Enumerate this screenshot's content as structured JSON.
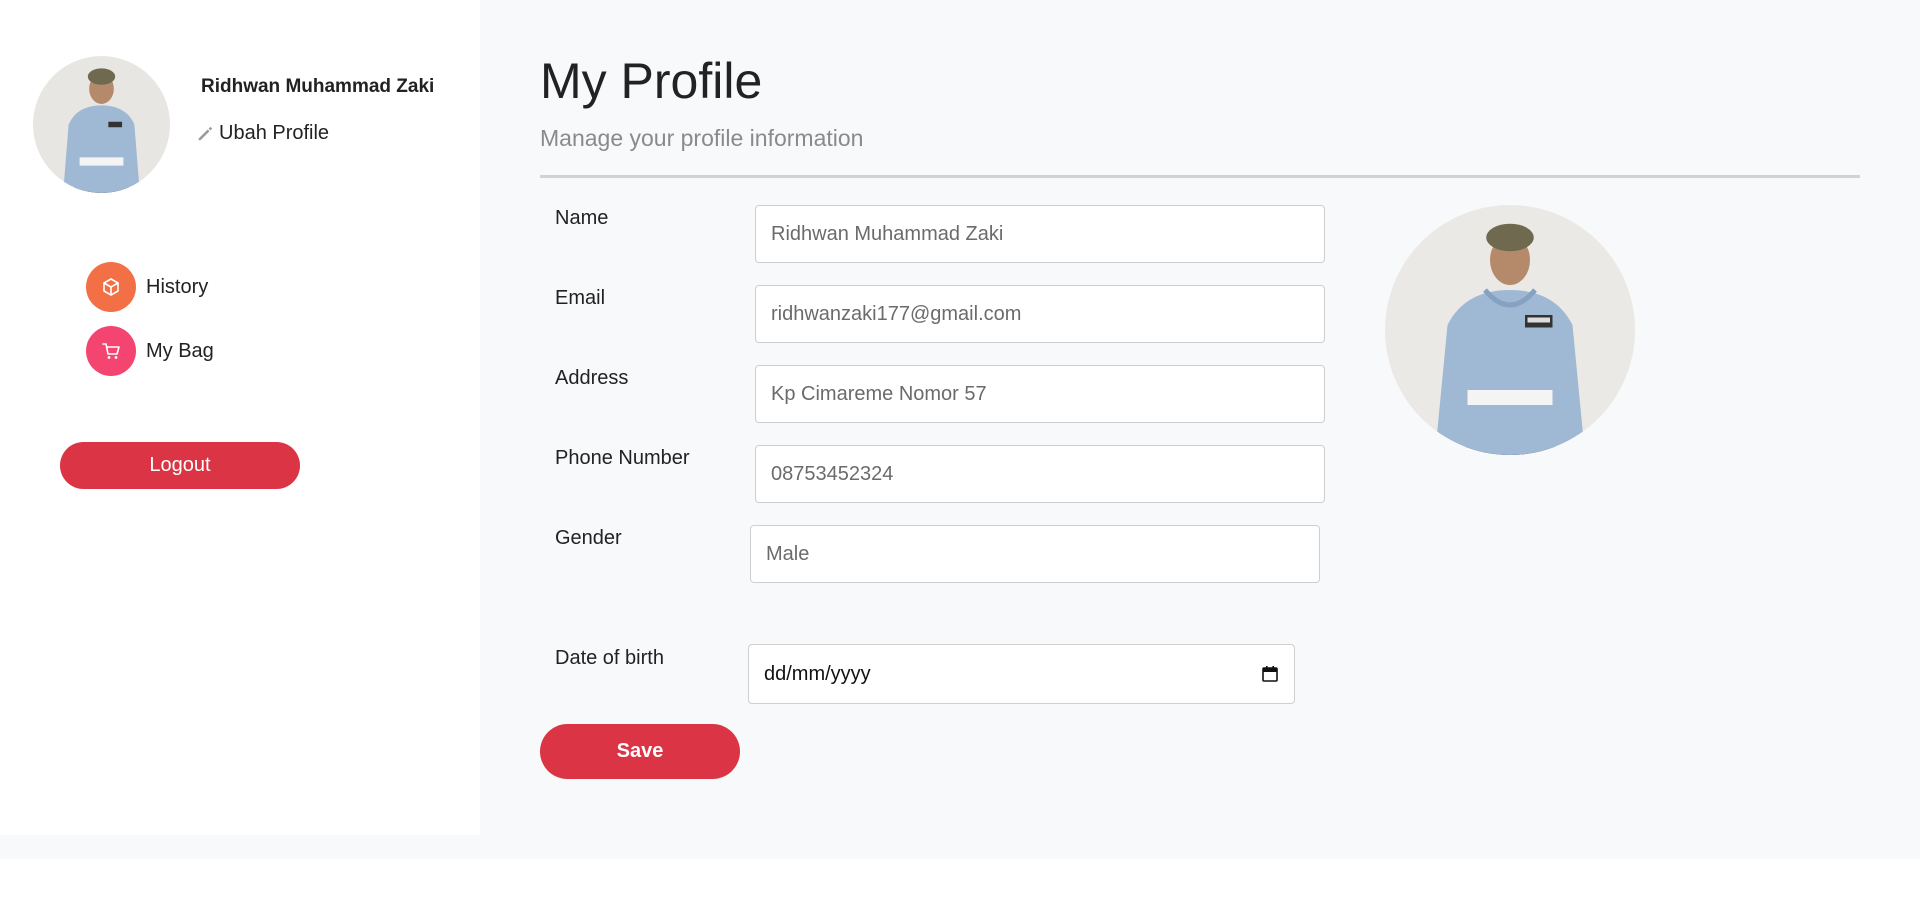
{
  "sidebar": {
    "user_name": "Ridhwan Muhammad Zaki",
    "edit_profile_label": "Ubah Profile",
    "nav_items": [
      {
        "label": "History",
        "icon": "package-icon",
        "color": "#f36f45"
      },
      {
        "label": "My Bag",
        "icon": "cart-icon",
        "color": "#f3456f"
      }
    ],
    "logout_label": "Logout"
  },
  "main": {
    "title": "My Profile",
    "subtitle": "Manage your profile information",
    "fields": {
      "name": {
        "label": "Name",
        "value": "Ridhwan Muhammad Zaki"
      },
      "email": {
        "label": "Email",
        "value": "ridhwanzaki177@gmail.com"
      },
      "address": {
        "label": "Address",
        "value": "Kp Cimareme Nomor 57"
      },
      "phone": {
        "label": "Phone Number",
        "value": "08753452324"
      },
      "gender": {
        "label": "Gender",
        "value": "Male"
      },
      "dob": {
        "label": "Date of birth",
        "value": "dd/mm/yyyy"
      }
    },
    "save_label": "Save"
  },
  "colors": {
    "accent": "#db3445",
    "history_icon": "#f36f45",
    "bag_icon": "#f3456f",
    "background": "#f8f9fa"
  }
}
